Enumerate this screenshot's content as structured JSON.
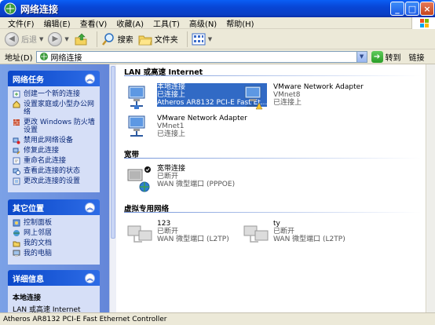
{
  "window": {
    "title": "网络连接"
  },
  "menu": {
    "items": [
      "文件(F)",
      "编辑(E)",
      "查看(V)",
      "收藏(A)",
      "工具(T)",
      "高级(N)",
      "帮助(H)"
    ]
  },
  "toolbar": {
    "back": "后退",
    "search": "搜索",
    "folders": "文件夹"
  },
  "address": {
    "label": "地址(D)",
    "value": "网络连接",
    "go": "转到",
    "links": "链接"
  },
  "left": {
    "network_tasks": {
      "title": "网络任务",
      "items": [
        "创建一个新的连接",
        "设置家庭或小型办公网络",
        "更改 Windows 防火墙设置",
        "禁用此网络设备",
        "修复此连接",
        "重命名此连接",
        "查看此连接的状态",
        "更改此连接的设置"
      ]
    },
    "other_places": {
      "title": "其它位置",
      "items": [
        "控制面板",
        "网上邻居",
        "我的文档",
        "我的电脑"
      ]
    },
    "details": {
      "title": "详细信息",
      "name": "本地连接",
      "type": "LAN 或高速 Internet"
    }
  },
  "groups": {
    "lan": "LAN 或高速 Internet",
    "broadband": "宽带",
    "vpn": "虚拟专用网络"
  },
  "connections": {
    "local": {
      "name": "本地连接",
      "status": "已连接上",
      "device": "Atheros AR8132 PCI-E Fast Et..."
    },
    "vmnet8": {
      "name": "VMware Network Adapter",
      "sub": "VMnet8",
      "status": "已连接上"
    },
    "vmnet1": {
      "name": "VMware Network Adapter",
      "sub": "VMnet1",
      "status": "已连接上"
    },
    "broadband": {
      "name": "宽带连接",
      "status": "已断开",
      "device": "WAN 微型端口 (PPPOE)"
    },
    "vpn123": {
      "name": "123",
      "status": "已断开",
      "device": "WAN 微型端口 (L2TP)"
    },
    "vpnty": {
      "name": "ty",
      "status": "已断开",
      "device": "WAN 微型端口 (L2TP)"
    }
  },
  "status": {
    "text": "Atheros AR8132 PCI-E Fast Ethernet Controller"
  },
  "colors": {
    "titlebar": "#0a5ef5",
    "selection": "#316ac5",
    "taskpane": "#6385d8"
  }
}
